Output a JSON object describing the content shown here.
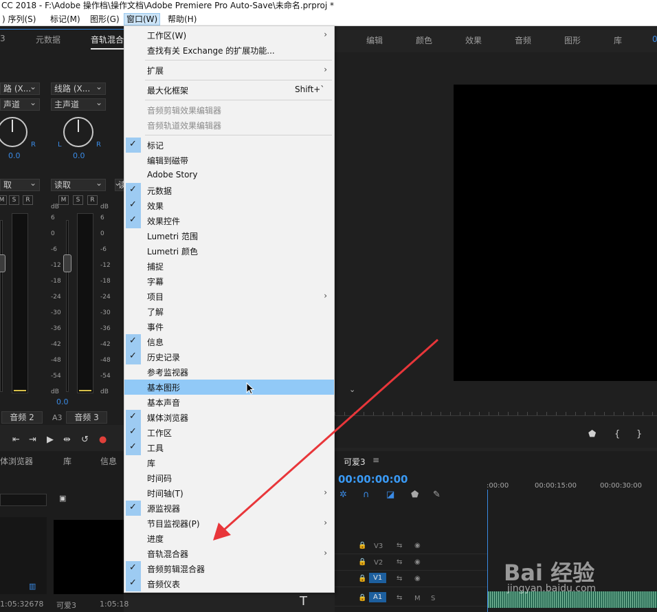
{
  "title": "CC 2018 - F:\\Adobe 操作档\\操作文档\\Adobe Premiere Pro Auto-Save\\未命名.prproj *",
  "menubar": [
    ")  序列(S)",
    "标记(M)",
    "图形(G)",
    "窗口(W)",
    "帮助(H)"
  ],
  "left_panel": {
    "tabs": [
      "3",
      "元数据",
      "音轨混合"
    ],
    "routes": [
      "路 (X...",
      "线路 (X...",
      "声道",
      "主声道"
    ],
    "pan_values": [
      "0.0",
      "0.0"
    ],
    "lr": [
      "R",
      "L",
      "R"
    ],
    "modes": [
      "取",
      "读取",
      "读"
    ],
    "msr": [
      "M",
      "S",
      "R"
    ],
    "db_unit": "dB",
    "db_left": [
      "6",
      "0",
      "-6",
      "-12",
      "-18",
      "-24",
      "-30",
      "-36",
      "-42",
      "-48",
      "-54",
      "dB"
    ],
    "db_right": [
      "6",
      "0",
      "-6",
      "-12",
      "-18",
      "-24",
      "-30",
      "-36",
      "-42",
      "-48",
      "-54",
      "dB"
    ],
    "fader_values": [
      "0.0",
      "0.0"
    ],
    "channels": [
      "音频 2",
      "A3",
      "音频 3"
    ]
  },
  "project_panel": {
    "tabs": [
      "体浏览器",
      "库",
      "信息"
    ],
    "duration_left": "1:05:32678",
    "clip_name": "可爱3",
    "clip_duration": "1:05:18"
  },
  "workspace_tabs": [
    "编辑",
    "颜色",
    "效果",
    "音频",
    "图形",
    "库",
    "0"
  ],
  "timeline": {
    "sequence": "可爱3",
    "menu_icon": "≡",
    "timecode": "00:00:00:00",
    "ruler": [
      ":00:00",
      "00:00:15:00",
      "00:00:30:00"
    ],
    "tracks": [
      {
        "label": "V3"
      },
      {
        "label": "V2"
      },
      {
        "label": "V1"
      },
      {
        "label": "A1"
      }
    ],
    "m": "M",
    "s": "S",
    "text_tool": "T"
  },
  "menu": {
    "items": [
      {
        "label": "工作区(W)",
        "arrow": "›"
      },
      {
        "label": "查找有关 Exchange 的扩展功能..."
      },
      {
        "label": "扩展",
        "arrow": "›"
      },
      {
        "label": "最大化框架",
        "shortcut": "Shift+`"
      },
      {
        "label": "音频剪辑效果编辑器",
        "disabled": true
      },
      {
        "label": "音频轨道效果编辑器",
        "disabled": true
      },
      {
        "label": "标记",
        "checked": true
      },
      {
        "label": "编辑到磁带"
      },
      {
        "label": "Adobe Story"
      },
      {
        "label": "元数据",
        "checked": true
      },
      {
        "label": "效果",
        "checked": true
      },
      {
        "label": "效果控件",
        "checked": true
      },
      {
        "label": "Lumetri 范围"
      },
      {
        "label": "Lumetri 颜色"
      },
      {
        "label": "捕捉"
      },
      {
        "label": "字幕"
      },
      {
        "label": "项目",
        "arrow": "›"
      },
      {
        "label": "了解"
      },
      {
        "label": "事件"
      },
      {
        "label": "信息",
        "checked": true
      },
      {
        "label": "历史记录",
        "checked": true
      },
      {
        "label": "参考监视器"
      },
      {
        "label": "基本图形",
        "highlighted": true
      },
      {
        "label": "基本声音"
      },
      {
        "label": "媒体浏览器",
        "checked": true
      },
      {
        "label": "工作区",
        "checked": true
      },
      {
        "label": "工具",
        "checked": true
      },
      {
        "label": "库"
      },
      {
        "label": "时间码"
      },
      {
        "label": "时间轴(T)",
        "arrow": "›"
      },
      {
        "label": "源监视器",
        "checked": true
      },
      {
        "label": "节目监视器(P)",
        "arrow": "›"
      },
      {
        "label": "进度"
      },
      {
        "label": "音轨混合器",
        "arrow": "›"
      },
      {
        "label": "音频剪辑混合器",
        "checked": true
      },
      {
        "label": "音频仪表",
        "checked": true
      }
    ]
  },
  "watermark": {
    "brand": "Bai 经验",
    "url": "jingyan.baidu.com"
  },
  "colors": {
    "accent": "#3a9af5",
    "highlight": "#91c9f7",
    "check_bg": "#9dcbf2",
    "arrow": "#e8363a"
  }
}
